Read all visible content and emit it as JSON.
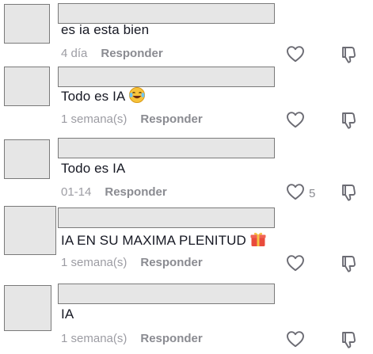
{
  "comments": [
    {
      "text": "es ia esta bien",
      "date": "4 día",
      "reply_label": "Responder",
      "like_count": "",
      "emoji": ""
    },
    {
      "text": "Todo es IA",
      "date": "1 semana(s)",
      "reply_label": "Responder",
      "like_count": "",
      "emoji": "laughing-tears-emoji"
    },
    {
      "text": "Todo es IA",
      "date": "01-14",
      "reply_label": "Responder",
      "like_count": "5",
      "emoji": ""
    },
    {
      "text": "IA EN SU MAXIMA PLENITUD",
      "date": "1 semana(s)",
      "reply_label": "Responder",
      "like_count": "",
      "emoji": "gift-emoji"
    },
    {
      "text": "IA",
      "date": "1 semana(s)",
      "reply_label": "Responder",
      "like_count": "",
      "emoji": ""
    }
  ],
  "icons": {
    "like": "heart-outline-icon",
    "dislike": "thumbs-down-outline-icon"
  },
  "colors": {
    "text": "#161823",
    "meta": "#9c9ca3",
    "reply": "#8a8b91",
    "placeholder": "#e6e6e6"
  }
}
